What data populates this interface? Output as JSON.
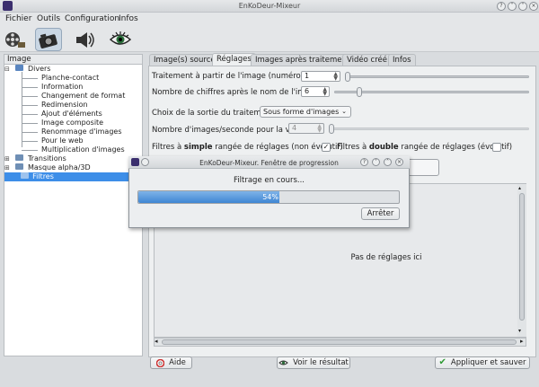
{
  "window": {
    "title": "EnKoDeur-Mixeur"
  },
  "menu": [
    "Fichier",
    "Outils",
    "Configuration",
    "Infos"
  ],
  "toolbar": {
    "tools": [
      {
        "icon": "film-reel-icon",
        "active": false
      },
      {
        "icon": "camera-icon",
        "active": true
      },
      {
        "icon": "speaker-icon",
        "active": false
      },
      {
        "icon": "eye-icon",
        "active": false
      }
    ]
  },
  "left": {
    "header": "Image",
    "tree": [
      {
        "label": "Divers",
        "level": 0,
        "expanded": true
      },
      {
        "label": "Planche-contact",
        "level": 1
      },
      {
        "label": "Information",
        "level": 1
      },
      {
        "label": "Changement de format",
        "level": 1
      },
      {
        "label": "Redimension",
        "level": 1
      },
      {
        "label": "Ajout d'éléments",
        "level": 1
      },
      {
        "label": "Image composite",
        "level": 1
      },
      {
        "label": "Renommage d'images",
        "level": 1
      },
      {
        "label": "Pour le web",
        "level": 1
      },
      {
        "label": "Multiplication d'images",
        "level": 1
      },
      {
        "label": "Transitions",
        "level": 0,
        "expanded": false
      },
      {
        "label": "Masque alpha/3D",
        "level": 0,
        "expanded": false
      },
      {
        "label": "Filtres",
        "level": 0,
        "selected": true
      }
    ]
  },
  "tabs": [
    {
      "label": "Image(s) source",
      "active": false
    },
    {
      "label": "Réglages",
      "active": true
    },
    {
      "label": "Images après traitement",
      "active": false
    },
    {
      "label": "Vidéo créé",
      "active": false
    },
    {
      "label": "Infos",
      "active": false
    }
  ],
  "settings": {
    "start_label": "Traitement à partir de l'image (numéro)",
    "start_value": "1",
    "start_slider": 0.0,
    "digits_label": "Nombre de chiffres après le nom de l'image",
    "digits_value": "6",
    "digits_slider": 0.12,
    "output_label": "Choix de la sortie du traitement",
    "output_value": "Sous forme d'images",
    "fps_label": "Nombre d'images/seconde pour la vidéo",
    "fps_value": "4",
    "fps_slider": 0.0,
    "simple_pre": "Filtres à ",
    "simple_bold": "simple",
    "simple_post": " rangée de réglages (non évolutif)",
    "simple_checked": true,
    "double_pre": "Filtres à ",
    "double_bold": "double",
    "double_post": " rangée de réglages (évolutif)",
    "double_checked": false,
    "empty_message": "Pas de réglages ici"
  },
  "buttons": {
    "help": "Aide",
    "view": "Voir le résultat",
    "apply": "Appliquer et sauver"
  },
  "dialog": {
    "title": "EnKoDeur-Mixeur. Fenêtre de progression",
    "status": "Filtrage en cours...",
    "progress": 0.54,
    "progress_text": "54%",
    "stop": "Arrêter"
  }
}
